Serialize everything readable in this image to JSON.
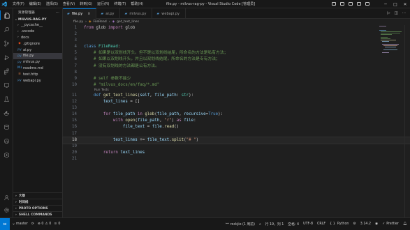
{
  "window": {
    "title": "file.py - milvus-rag-py - Visual Studio Code [管理员]",
    "menu": [
      "文件(F)",
      "编辑(E)",
      "选择(S)",
      "查看(V)",
      "转到(G)",
      "运行(R)",
      "终端(T)",
      "帮助(H)"
    ],
    "controls": {
      "minimize": "─",
      "maximize": "□",
      "close": "✕"
    }
  },
  "sidebar": {
    "title": "资源管理器",
    "more": "···",
    "root": "MILVUS-RAG-PY",
    "items": [
      {
        "name": "__pycache__",
        "type": "folder",
        "icon": "›"
      },
      {
        "name": ".vscode",
        "type": "folder",
        "icon": "›"
      },
      {
        "name": "docs",
        "type": "folder",
        "icon": "›"
      },
      {
        "name": ".gitignore",
        "type": "file",
        "icon": "◆"
      },
      {
        "name": "ai.py",
        "type": "file",
        "icon": "py"
      },
      {
        "name": "file.py",
        "type": "file",
        "icon": "py",
        "selected": true
      },
      {
        "name": "milvus.py",
        "type": "file",
        "icon": "py"
      },
      {
        "name": "readme.md",
        "type": "file",
        "icon": "M↓"
      },
      {
        "name": "test.http",
        "type": "file",
        "icon": "≡"
      },
      {
        "name": "webapi.py",
        "type": "file",
        "icon": "py"
      }
    ],
    "sections": [
      "大纲",
      "时间线",
      "PROTO OPTIONS",
      "SHELL COMMANDS"
    ]
  },
  "tabs": [
    {
      "label": "file.py",
      "active": true
    },
    {
      "label": "ai.py",
      "active": false
    },
    {
      "label": "milvus.py",
      "active": false
    },
    {
      "label": "webapi.py",
      "active": false
    }
  ],
  "breadcrumb": [
    "file.py",
    "FileRead",
    "get_text_lines"
  ],
  "codelens": "Run Tests",
  "editor": {
    "current_line": 18,
    "line_numbers": [
      "1",
      "2",
      "3",
      "4",
      "5",
      "6",
      "7",
      "8",
      "9",
      "10",
      "11",
      "12",
      "13",
      "14",
      "15",
      "16",
      "17",
      "18",
      "19",
      "20",
      "21"
    ]
  },
  "statusbar": {
    "branch": "master",
    "errors": "⊗ 0",
    "warnings": "⚠ 0",
    "ports": "0",
    "remote": "rockjie (1 周前)",
    "position": "行 19，列 1",
    "spaces": "空格: 4",
    "encoding": "UTF-8",
    "eol": "CRLF",
    "braces": "{ }",
    "language": "Python",
    "version": "3.14.2",
    "prettier": "Prettier"
  },
  "colors": {
    "accent": "#0078d4",
    "background": "#1f1f1f",
    "panel": "#181818"
  }
}
